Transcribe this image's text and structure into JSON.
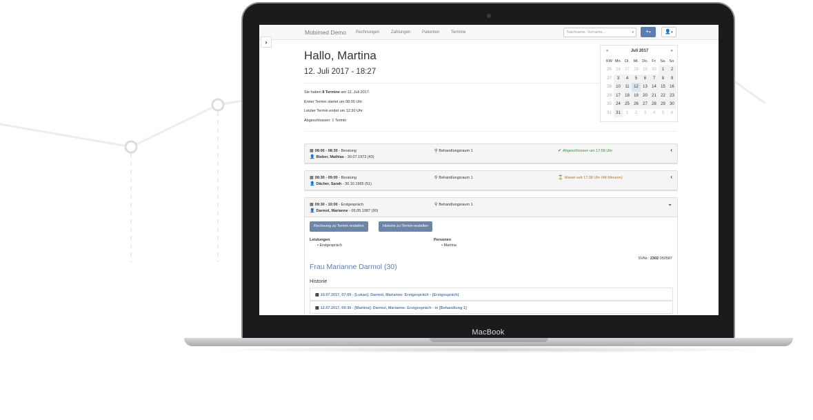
{
  "device": {
    "label": "MacBook"
  },
  "app": {
    "brand": "Mobimed Demo",
    "nav": [
      "Rechnungen",
      "Zahlungen",
      "Patienten",
      "Termine"
    ],
    "search_placeholder": "Nachname, Vorname...",
    "add_button": "+",
    "user_button": "👤"
  },
  "dashboard": {
    "greeting": "Hallo, Martina",
    "datetime": "12. Juli 2017 - 18:27",
    "summary": {
      "line1_pre": "Sie haben",
      "line1_count": "8 Termine",
      "line1_post": "am 12. Juli 2017.",
      "line2": "Erster Termin startet um 08:00 Uhr",
      "line3": "Letzter Termin endet um 12:30 Uhr",
      "line4": "Abgeschlossen: 1 Termin"
    }
  },
  "calendar": {
    "prev": "«",
    "next": "»",
    "title": "Juli 2017",
    "headers": [
      "KW",
      "Mo.",
      "Di.",
      "Mi.",
      "Do.",
      "Fr.",
      "Sa.",
      "So."
    ],
    "weeks": [
      [
        "26",
        "26",
        "27",
        "28",
        "29",
        "30",
        "1",
        "2"
      ],
      [
        "27",
        "3",
        "4",
        "5",
        "6",
        "7",
        "8",
        "9"
      ],
      [
        "28",
        "10",
        "11",
        "12",
        "13",
        "14",
        "15",
        "16"
      ],
      [
        "29",
        "17",
        "18",
        "19",
        "20",
        "21",
        "22",
        "23"
      ],
      [
        "30",
        "24",
        "25",
        "26",
        "27",
        "28",
        "29",
        "30"
      ],
      [
        "31",
        "31",
        "1",
        "2",
        "3",
        "4",
        "5",
        "6"
      ]
    ]
  },
  "appointments": [
    {
      "time": "08:00 - 08:30",
      "type": "Beratung",
      "patient": "Bieber, Mathias",
      "birth": "30.07.1973 (43)",
      "room": "Behandlungsraum 1",
      "status": "Abgeschlossen um 17:58 Uhr",
      "status_color": "#3c8c3c",
      "chevron": "‹"
    },
    {
      "time": "08:30 - 09:00",
      "type": "Beratung",
      "patient": "Dächer, Sarah",
      "birth": "30.10.1965 (51)",
      "room": "Behandlungsraum 1",
      "status": "Wartet seit 17:38 Uhr (48 Minuten)",
      "status_color": "#a8782e",
      "chevron": "‹"
    },
    {
      "time": "09:30 - 10:00",
      "type": "Erstgespräch",
      "patient": "Darmol, Marianne",
      "birth": "05.05.1987 (30)",
      "room": "Behandlungsraum 1",
      "status": "",
      "status_color": "#333333",
      "chevron": "⌄"
    }
  ],
  "detail": {
    "btn_invoice": "Rechnung zu Termin erstellen",
    "btn_history": "Historie zu Termin erstellen",
    "services_label": "Leistungen",
    "services": [
      "Erstgespräch"
    ],
    "persons_label": "Personen",
    "persons": [
      "Martina"
    ],
    "svnr_label": "SVNr.:",
    "svnr_bold": "2302",
    "svnr_rest": "050587",
    "patient_name": "Frau Marianne Darmol (30)",
    "history_title": "Historie",
    "history": [
      "10.07.2017, 07:00 - [Lukas]: Darmol, Marianne: Erstgespräch - (Erstgespräch)",
      "12.07.2017, 09:30 - [Martina]: Darmol, Marianne: Erstgespräch - in [Behandlung 1]"
    ]
  }
}
